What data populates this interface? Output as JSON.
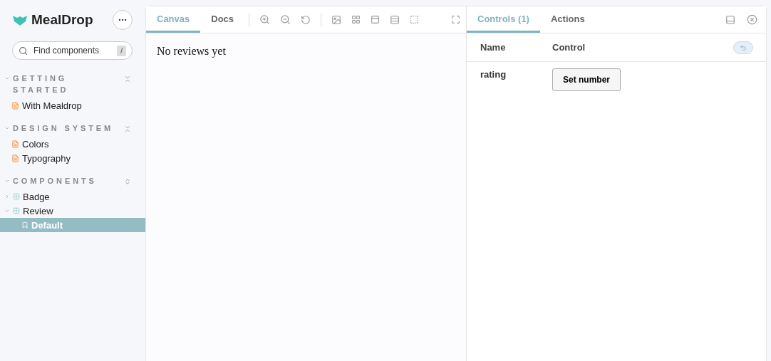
{
  "brand": {
    "name": "MealDrop"
  },
  "search": {
    "placeholder": "Find components",
    "shortcut": "/"
  },
  "sections": [
    {
      "title": "GETTING STARTED",
      "items": [
        {
          "kind": "doc",
          "label": "With Mealdrop",
          "selected": false
        }
      ]
    },
    {
      "title": "DESIGN SYSTEM",
      "items": [
        {
          "kind": "doc",
          "label": "Colors",
          "selected": false
        },
        {
          "kind": "doc",
          "label": "Typography",
          "selected": false
        }
      ]
    },
    {
      "title": "COMPONENTS",
      "items": [
        {
          "kind": "component",
          "label": "Badge",
          "expanded": false,
          "selected": false
        },
        {
          "kind": "component",
          "label": "Review",
          "expanded": true,
          "selected": false,
          "children": [
            {
              "kind": "story",
              "label": "Default",
              "selected": true
            }
          ]
        }
      ]
    }
  ],
  "canvas_tabs": [
    {
      "label": "Canvas",
      "selected": true
    },
    {
      "label": "Docs",
      "selected": false
    }
  ],
  "preview": {
    "text": "No reviews yet"
  },
  "addon_tabs": [
    {
      "label": "Controls (1)",
      "selected": true
    },
    {
      "label": "Actions",
      "selected": false
    }
  ],
  "controls": {
    "columns": [
      "Name",
      "Control"
    ],
    "rows": [
      {
        "name": "rating",
        "control": "Set number"
      }
    ]
  }
}
